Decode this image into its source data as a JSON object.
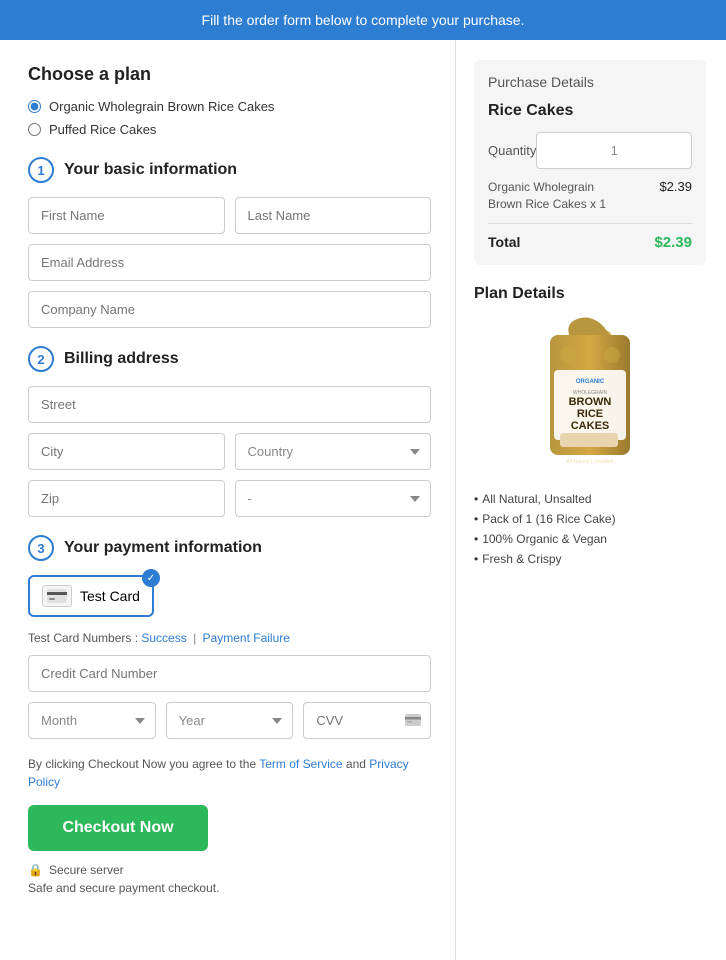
{
  "banner": {
    "text": "Fill the order form below to complete your purchase."
  },
  "left": {
    "plan_section": {
      "title": "Choose a plan",
      "options": [
        {
          "id": "organic",
          "label": "Organic Wholegrain Brown Rice Cakes",
          "checked": true
        },
        {
          "id": "puffed",
          "label": "Puffed Rice Cakes",
          "checked": false
        }
      ]
    },
    "basic_info": {
      "step": "1",
      "title": "Your basic information",
      "first_name_placeholder": "First Name",
      "last_name_placeholder": "Last Name",
      "email_placeholder": "Email Address",
      "company_placeholder": "Company Name"
    },
    "billing": {
      "step": "2",
      "title": "Billing address",
      "street_placeholder": "Street",
      "city_placeholder": "City",
      "country_placeholder": "Country",
      "zip_placeholder": "Zip",
      "state_placeholder": "-"
    },
    "payment": {
      "step": "3",
      "title": "Your payment information",
      "card_label": "Test Card",
      "test_card_label": "Test Card Numbers : ",
      "success_link": "Success",
      "separator": "|",
      "failure_link": "Payment Failure",
      "cc_placeholder": "Credit Card Number",
      "month_placeholder": "Month",
      "year_placeholder": "Year",
      "cvv_placeholder": "CVV"
    },
    "terms": {
      "text_before": "By clicking Checkout Now you agree to the ",
      "tos_link": "Term of Service",
      "text_middle": " and ",
      "privacy_link": "Privacy Policy"
    },
    "checkout": {
      "button_label": "Checkout Now"
    },
    "secure": {
      "label": "Secure server",
      "sublabel": "Safe and secure payment checkout."
    }
  },
  "right": {
    "purchase_details": {
      "title": "Purchase Details",
      "product_name": "Rice Cakes",
      "quantity_label": "Quantity",
      "quantity_value": "1",
      "item_name": "Organic Wholegrain\nBrown Rice Cakes x 1",
      "item_price": "$2.39",
      "total_label": "Total",
      "total_price": "$2.39"
    },
    "plan_details": {
      "title": "Plan Details",
      "features": [
        "All Natural, Unsalted",
        "Pack of 1 (16 Rice Cake)",
        "100% Organic & Vegan",
        "Fresh & Crispy"
      ]
    }
  }
}
